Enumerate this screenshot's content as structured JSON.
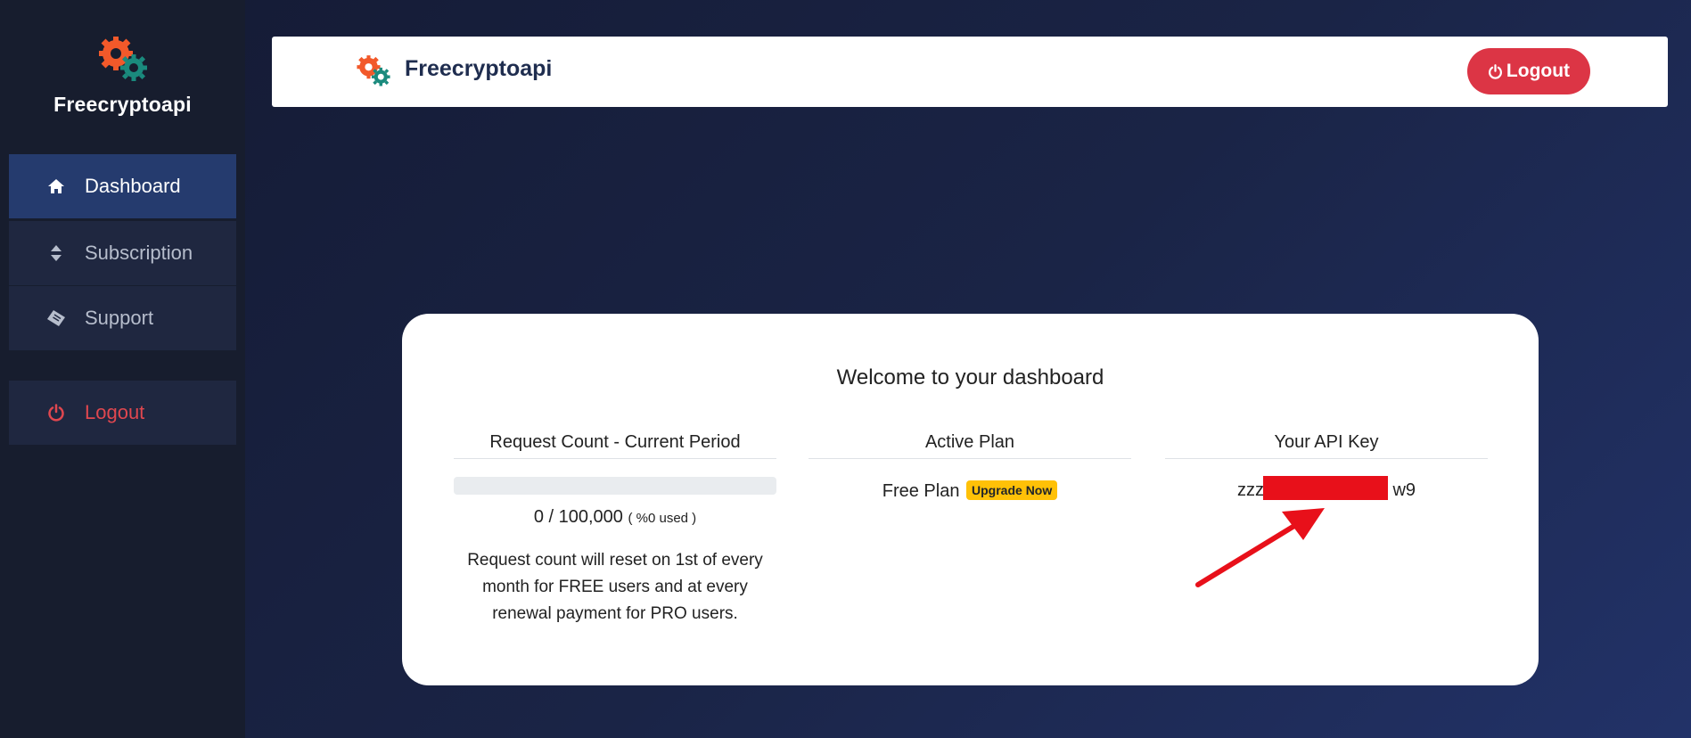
{
  "app": {
    "name": "Freecryptoapi"
  },
  "sidebar": {
    "brand": "Freecryptoapi",
    "items": [
      {
        "label": "Dashboard",
        "icon": "home-icon",
        "active": true
      },
      {
        "label": "Subscription",
        "icon": "sort-icon"
      },
      {
        "label": "Support",
        "icon": "ticket-icon"
      }
    ],
    "logout": {
      "label": "Logout",
      "icon": "power-icon"
    }
  },
  "header": {
    "title": "Freecryptoapi",
    "logout_label": "Logout"
  },
  "dashboard": {
    "welcome": "Welcome to your dashboard",
    "request_count": {
      "heading": "Request Count - Current Period",
      "used": 0,
      "count_text": "0 / 100,000",
      "percent_text": "( %0 used )",
      "note": "Request count will reset on 1st of every month for FREE users and at every renewal payment for PRO users."
    },
    "plan": {
      "heading": "Active Plan",
      "name": "Free Plan",
      "upgrade_label": "Upgrade Now"
    },
    "api_key": {
      "heading": "Your API Key",
      "prefix": "zzzj",
      "suffix": "w9"
    }
  },
  "colors": {
    "sidebar_bg": "#171d2e",
    "active_item": "#253b6e",
    "logout_red": "#dc3545",
    "badge_yellow": "#ffc107",
    "redaction": "#e8101a",
    "logo_orange": "#f2592a",
    "logo_teal": "#1a8a7d"
  }
}
